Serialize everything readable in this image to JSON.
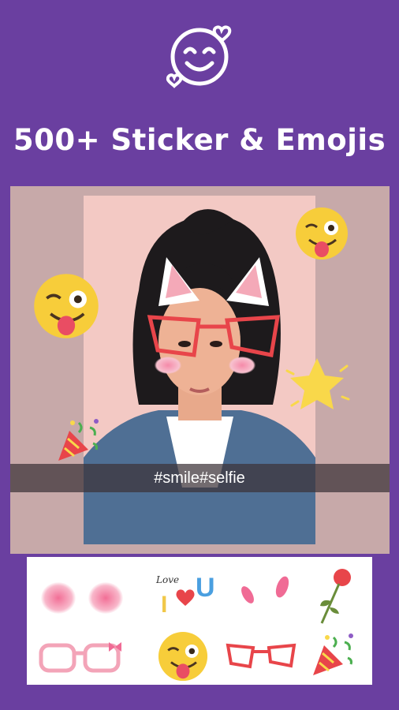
{
  "header": {
    "icon": "smiley-heart-icon",
    "title": "500+ Sticker & Emojis"
  },
  "preview": {
    "caption": "#smile#selfie",
    "stickers_on_photo": [
      "winking-emoji",
      "winking-emoji",
      "cat-ears",
      "red-glasses",
      "blush-cheeks",
      "star",
      "party-popper"
    ]
  },
  "tray": {
    "stickers": [
      {
        "name": "blush-sticker"
      },
      {
        "name": "i-love-you-sticker",
        "text_love": "Love",
        "text_i": "I",
        "text_u": "U"
      },
      {
        "name": "pink-ears-sticker"
      },
      {
        "name": "rose-sticker"
      },
      {
        "name": "pink-glasses-sticker"
      },
      {
        "name": "winking-emoji-sticker"
      },
      {
        "name": "red-glasses-sticker"
      },
      {
        "name": "party-popper-sticker"
      }
    ]
  },
  "colors": {
    "background": "#6a3fa0",
    "canvas": "#c7a9a9",
    "photo_bg": "#f3c9c4",
    "emoji_yellow": "#f7cd3a",
    "glasses_red": "#e8454a"
  }
}
